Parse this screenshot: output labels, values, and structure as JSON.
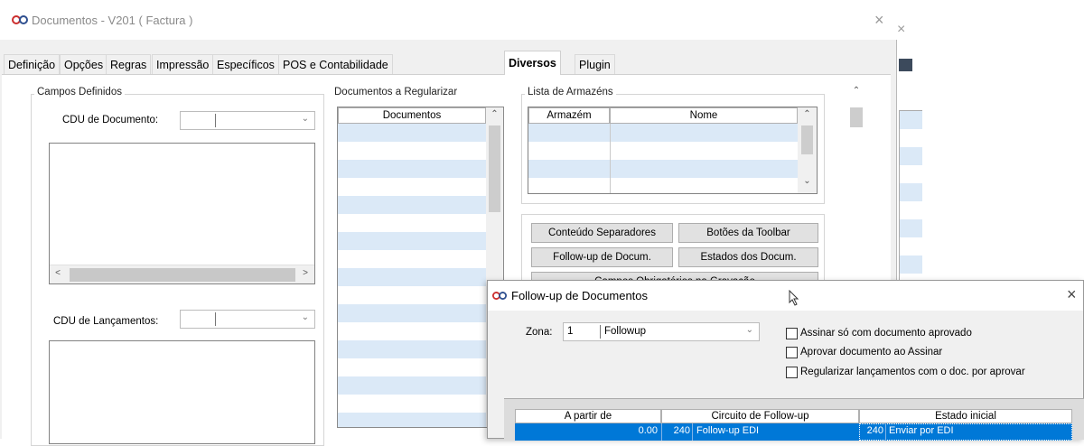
{
  "window": {
    "title": "Documentos - V201 ( Factura )",
    "close": "×"
  },
  "tabs": [
    "Definição",
    "Opções",
    "Regras",
    "Impressão",
    "Específicos",
    "POS e Contabilidade",
    "Diversos",
    "Plugin"
  ],
  "campos": {
    "group_title": "Campos Definidos",
    "cdu_documento_label": "CDU de Documento:",
    "cdu_lancamentos_label": "CDU de Lançamentos:"
  },
  "regularizar": {
    "group_title": "Documentos a Regularizar",
    "column": "Documentos"
  },
  "armazens": {
    "group_title": "Lista de Armazéns",
    "col1": "Armazém",
    "col2": "Nome"
  },
  "buttons": {
    "conteudo": "Conteúdo Separadores",
    "botoes": "Botões da Toolbar",
    "followup": "Follow-up de Docum.",
    "estados": "Estados dos Docum.",
    "campos_obrig": "Campos Obrigatórios na Gravação"
  },
  "dialog": {
    "title": "Follow-up de Documentos",
    "zona_label": "Zona:",
    "zona_code": "1",
    "zona_value": "Followup",
    "check1": "Assinar só com documento aprovado",
    "check2": "Aprovar documento ao Assinar",
    "check3": "Regularizar lançamentos com o doc. por aprovar",
    "grid_headers": [
      "A partir de",
      "Circuito de Follow-up",
      "Estado inicial"
    ],
    "row": {
      "apartir": "0.00",
      "circ_code": "240",
      "circ_name": "Follow-up EDI",
      "est_code": "240",
      "est_name": "Enviar por EDI"
    }
  },
  "colors": {
    "selection": "#0078d7",
    "alt_row": "#dbe9f7",
    "icon": "#cc2e2e"
  }
}
